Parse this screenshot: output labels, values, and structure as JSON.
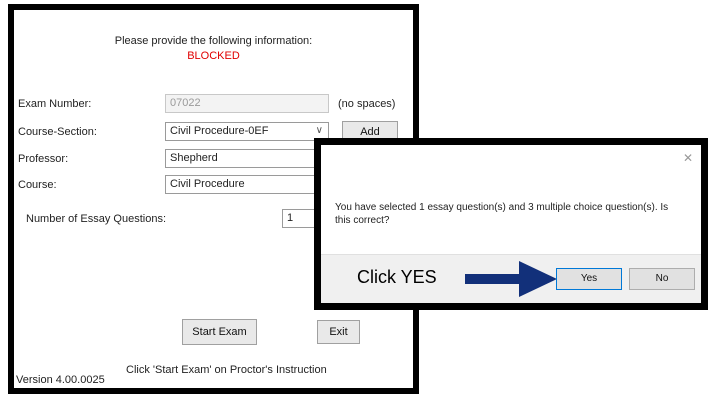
{
  "main_window": {
    "header_cut": "...",
    "instructions": "Please provide the following information:",
    "status": "BLOCKED",
    "exam_number": {
      "label": "Exam Number:",
      "value": "07022",
      "hint": "(no spaces)"
    },
    "course_section": {
      "label": "Course-Section:",
      "value": "Civil Procedure-0EF",
      "add_label": "Add"
    },
    "professor": {
      "label": "Professor:",
      "value": "Shepherd"
    },
    "course": {
      "label": "Course:",
      "value": "Civil Procedure"
    },
    "essay_questions": {
      "label": "Number of Essay Questions:",
      "value": "1"
    },
    "start_exam_label": "Start Exam",
    "exit_label": "Exit",
    "footer_instruction": "Click 'Start Exam' on Proctor's Instruction",
    "version": "Version 4.00.0025"
  },
  "dialog": {
    "message": "You have selected 1 essay question(s) and 3 multiple choice question(s).  Is this correct?",
    "yes_label": "Yes",
    "no_label": "No",
    "close_icon": "close-icon"
  },
  "annotation": {
    "label": "Click YES",
    "arrow_color": "#12307a"
  },
  "colors": {
    "blocked": "#e00000",
    "frame_border": "#000000"
  }
}
